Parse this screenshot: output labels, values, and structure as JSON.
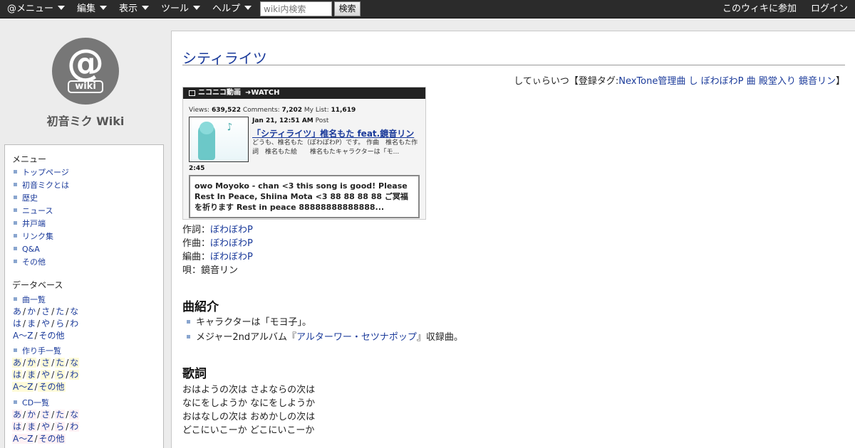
{
  "topbar": {
    "menus": [
      "@メニュー",
      "編集",
      "表示",
      "ツール",
      "ヘルプ"
    ],
    "search_placeholder": "wiki内検索",
    "search_button": "検索",
    "join": "このウィキに参加",
    "login": "ログイン"
  },
  "sidebar": {
    "logo_at": "@",
    "logo_wiki": "wiki",
    "site_name": "初音ミク Wiki",
    "menu_heading": "メニュー",
    "menu_items": [
      "トップページ",
      "初音ミクとは",
      "歴史",
      "ニュース",
      "井戸端",
      "リンク集",
      "Q&A",
      "その他"
    ],
    "db_heading": "データベース",
    "song_list": "曲一覧",
    "creator_list": "作り手一覧",
    "cd_list": "CD一覧",
    "kana_row1": [
      "あ",
      "か",
      "さ",
      "た",
      "な"
    ],
    "kana_row2": [
      "は",
      "ま",
      "や",
      "ら",
      "わ"
    ],
    "kana_row3": [
      "A～Z",
      "その他"
    ],
    "sep": "/"
  },
  "page": {
    "title": "シティライツ",
    "tag_prefix": "してぃらいつ【登録タグ:",
    "tags": [
      "NexTone管理曲",
      "し",
      "ぼわぼわP",
      "曲",
      "殿堂入り",
      "鏡音リン"
    ],
    "tag_suffix": "】"
  },
  "nico": {
    "logo": "ニコニコ動画",
    "watch": "➜WATCH",
    "views_label": "Views:",
    "views": "639,522",
    "comments_label": "Comments:",
    "comments": "7,202",
    "mylist_label": "My List:",
    "mylist": "11,619",
    "date": "Jan 21, 12:51 AM",
    "post": "Post",
    "video_title": "「シティライツ」椎名もた feat.鏡音リン",
    "description": "どうも、椎名もた（ぽわぽわP）です。 作曲　椎名もた作詞　椎名もた絵　　椎名もたキャラクターは「モ...",
    "duration": "2:45",
    "comment": "owo Moyoko - chan <3 this song is good! Please Rest In Peace, Shiina Mota <3 88 88 88 88 ご冥福を祈ります Rest in peace 88888888888888..."
  },
  "credits": [
    {
      "label": "作詞：",
      "value": "ぼわぼわP",
      "link": true
    },
    {
      "label": "作曲：",
      "value": "ぼわぼわP",
      "link": true
    },
    {
      "label": "編曲：",
      "value": "ぼわぼわP",
      "link": true
    },
    {
      "label": "唄：",
      "value": "鏡音リン",
      "link": false
    }
  ],
  "intro": {
    "heading": "曲紹介",
    "item1": "キャラクターは「モヨ子」。",
    "item2_prefix": "メジャー2ndアルバム『",
    "item2_link": "アルターワー・セツナポップ",
    "item2_suffix": "』収録曲。"
  },
  "lyrics": {
    "heading": "歌詞",
    "lines": [
      "おはようの次は さよならの次は",
      "なにをしようか なにをしようか",
      "おはなしの次は おめかしの次は",
      "どこにいこーか どこにいこーか"
    ]
  },
  "colors": {
    "topbar": "#2b2b2b",
    "link": "#1a3a9a",
    "bullet": "#8aa6cf"
  }
}
